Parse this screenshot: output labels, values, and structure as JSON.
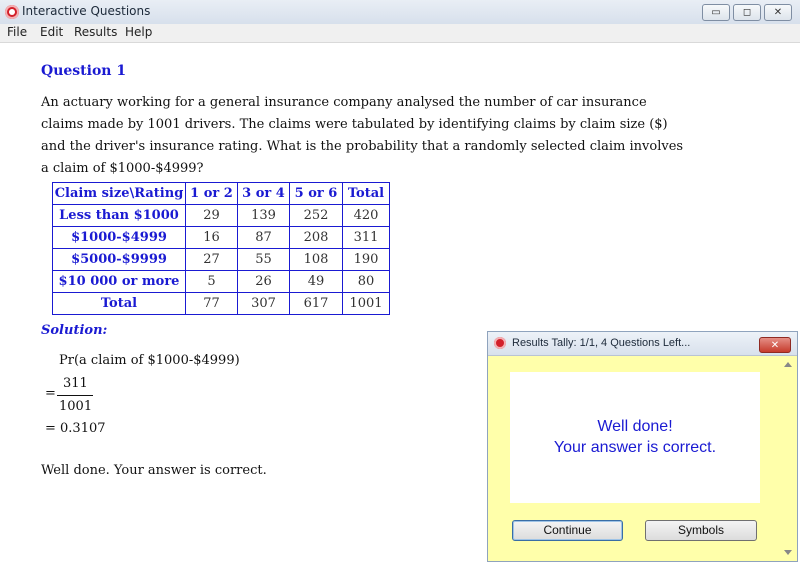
{
  "window": {
    "title": "Interactive Questions"
  },
  "menu": [
    "File",
    "Edit",
    "Results",
    "Help"
  ],
  "question": {
    "title": "Question 1",
    "lines": [
      "An actuary working for a general insurance company analysed the number of car insurance",
      "claims made by 1001 drivers.  The claims were tabulated by identifying claims by claim size ($)",
      "and the driver's insurance rating.  What is the probability that a randomly selected claim involves",
      "a claim of $1000-$4999?"
    ],
    "table": {
      "headers": [
        "Claim size\\Rating",
        "1 or 2",
        "3 or 4",
        "5 or 6",
        "Total"
      ],
      "rows": [
        [
          "Less than $1000",
          "29",
          "139",
          "252",
          "420"
        ],
        [
          "$1000-$4999",
          "16",
          "87",
          "208",
          "311"
        ],
        [
          "$5000-$9999",
          "27",
          "55",
          "108",
          "190"
        ],
        [
          "$10 000 or more",
          "5",
          "26",
          "49",
          "80"
        ],
        [
          "Total",
          "77",
          "307",
          "617",
          "1001"
        ]
      ]
    }
  },
  "solution": {
    "title": "Solution:",
    "pr": "Pr(a claim of $1000-$4999)",
    "eq": "=",
    "numerator": "311",
    "denominator": "1001",
    "result": "= 0.3107",
    "final": "Well done.  Your answer is correct."
  },
  "tally": {
    "title": "Results Tally: 1/1, 4 Questions Left...",
    "line1": "Well done!",
    "line2": "Your answer is correct.",
    "continue": "Continue",
    "symbols": "Symbols"
  }
}
